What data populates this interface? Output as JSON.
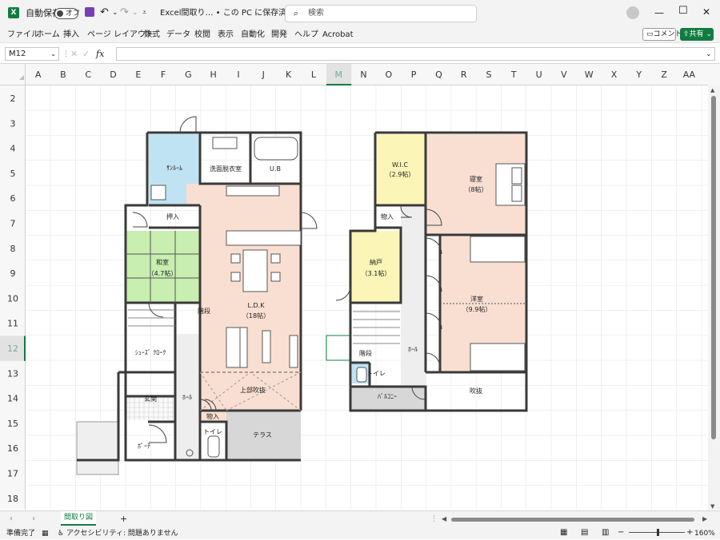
{
  "titlebar": {
    "autosave_label": "自動保存",
    "toggle_state": "オフ",
    "file_title": "Excel間取り… • この PC に保存済み",
    "search_placeholder": "検索"
  },
  "ribbon": {
    "tabs": [
      "ファイル",
      "ホーム",
      "挿入",
      "ページ レイアウト",
      "数式",
      "データ",
      "校閲",
      "表示",
      "自動化",
      "開発",
      "ヘルプ",
      "Acrobat"
    ],
    "comment_label": "コメント",
    "share_label": "共有"
  },
  "formula_bar": {
    "name_box": "M12",
    "fx": "fx",
    "value": ""
  },
  "sheet": {
    "columns": [
      "A",
      "B",
      "C",
      "D",
      "E",
      "F",
      "G",
      "H",
      "I",
      "J",
      "K",
      "L",
      "M",
      "N",
      "O",
      "P",
      "Q",
      "R",
      "S",
      "T",
      "U",
      "V",
      "W",
      "X",
      "Y",
      "Z",
      "AA"
    ],
    "rows": [
      "2",
      "3",
      "4",
      "5",
      "6",
      "7",
      "8",
      "9",
      "10",
      "11",
      "12",
      "13",
      "14",
      "15",
      "16",
      "17",
      "18"
    ],
    "active_col": "M",
    "active_row": "12"
  },
  "floorplan": {
    "floor1_rooms": {
      "sunroom": "ｻﾝﾙｰﾑ",
      "washroom": "洗面脱衣室",
      "bath": "U.B",
      "closet": "押入",
      "washitsu": "和室",
      "washitsu_size": "（4.7帖）",
      "ldk": "L.D.K",
      "ldk_size": "（18帖）",
      "stairs": "階段",
      "shoes": "ｼｭｰｽﾞ ｸﾛｰｸ",
      "entrance": "玄関",
      "hall": "ﾎｰﾙ",
      "storage": "物入",
      "void": "上部吹抜",
      "toilet": "トイレ",
      "terrace": "テラス",
      "porch": "ﾎﾟｰﾁ"
    },
    "floor2_rooms": {
      "wic": "W.I.C",
      "wic_size": "（2.9帖）",
      "bedroom": "寝室",
      "bedroom_size": "（8帖）",
      "storage": "物入",
      "nando": "納戸",
      "nando_size": "（3.1帖）",
      "youshitsu": "洋室",
      "youshitsu_size": "（9.9帖）",
      "stairs": "階段",
      "hall": "ﾎｰﾙ",
      "toilet": "トイレ",
      "balcony": "ﾊﾞﾙｺﾆｰ",
      "void": "吹抜"
    }
  },
  "sheet_tabs": {
    "active": "間取り図"
  },
  "status": {
    "ready": "準備完了",
    "accessibility": "アクセシビリティ: 問題ありません",
    "zoom": "160%"
  },
  "colors": {
    "excel_green": "#107c41",
    "sunroom": "#bfe3f3",
    "washitsu": "#c8eeb0",
    "ldk": "#f9dfd2",
    "wic": "#fbf5b8",
    "wall": "#3a3a3a"
  }
}
